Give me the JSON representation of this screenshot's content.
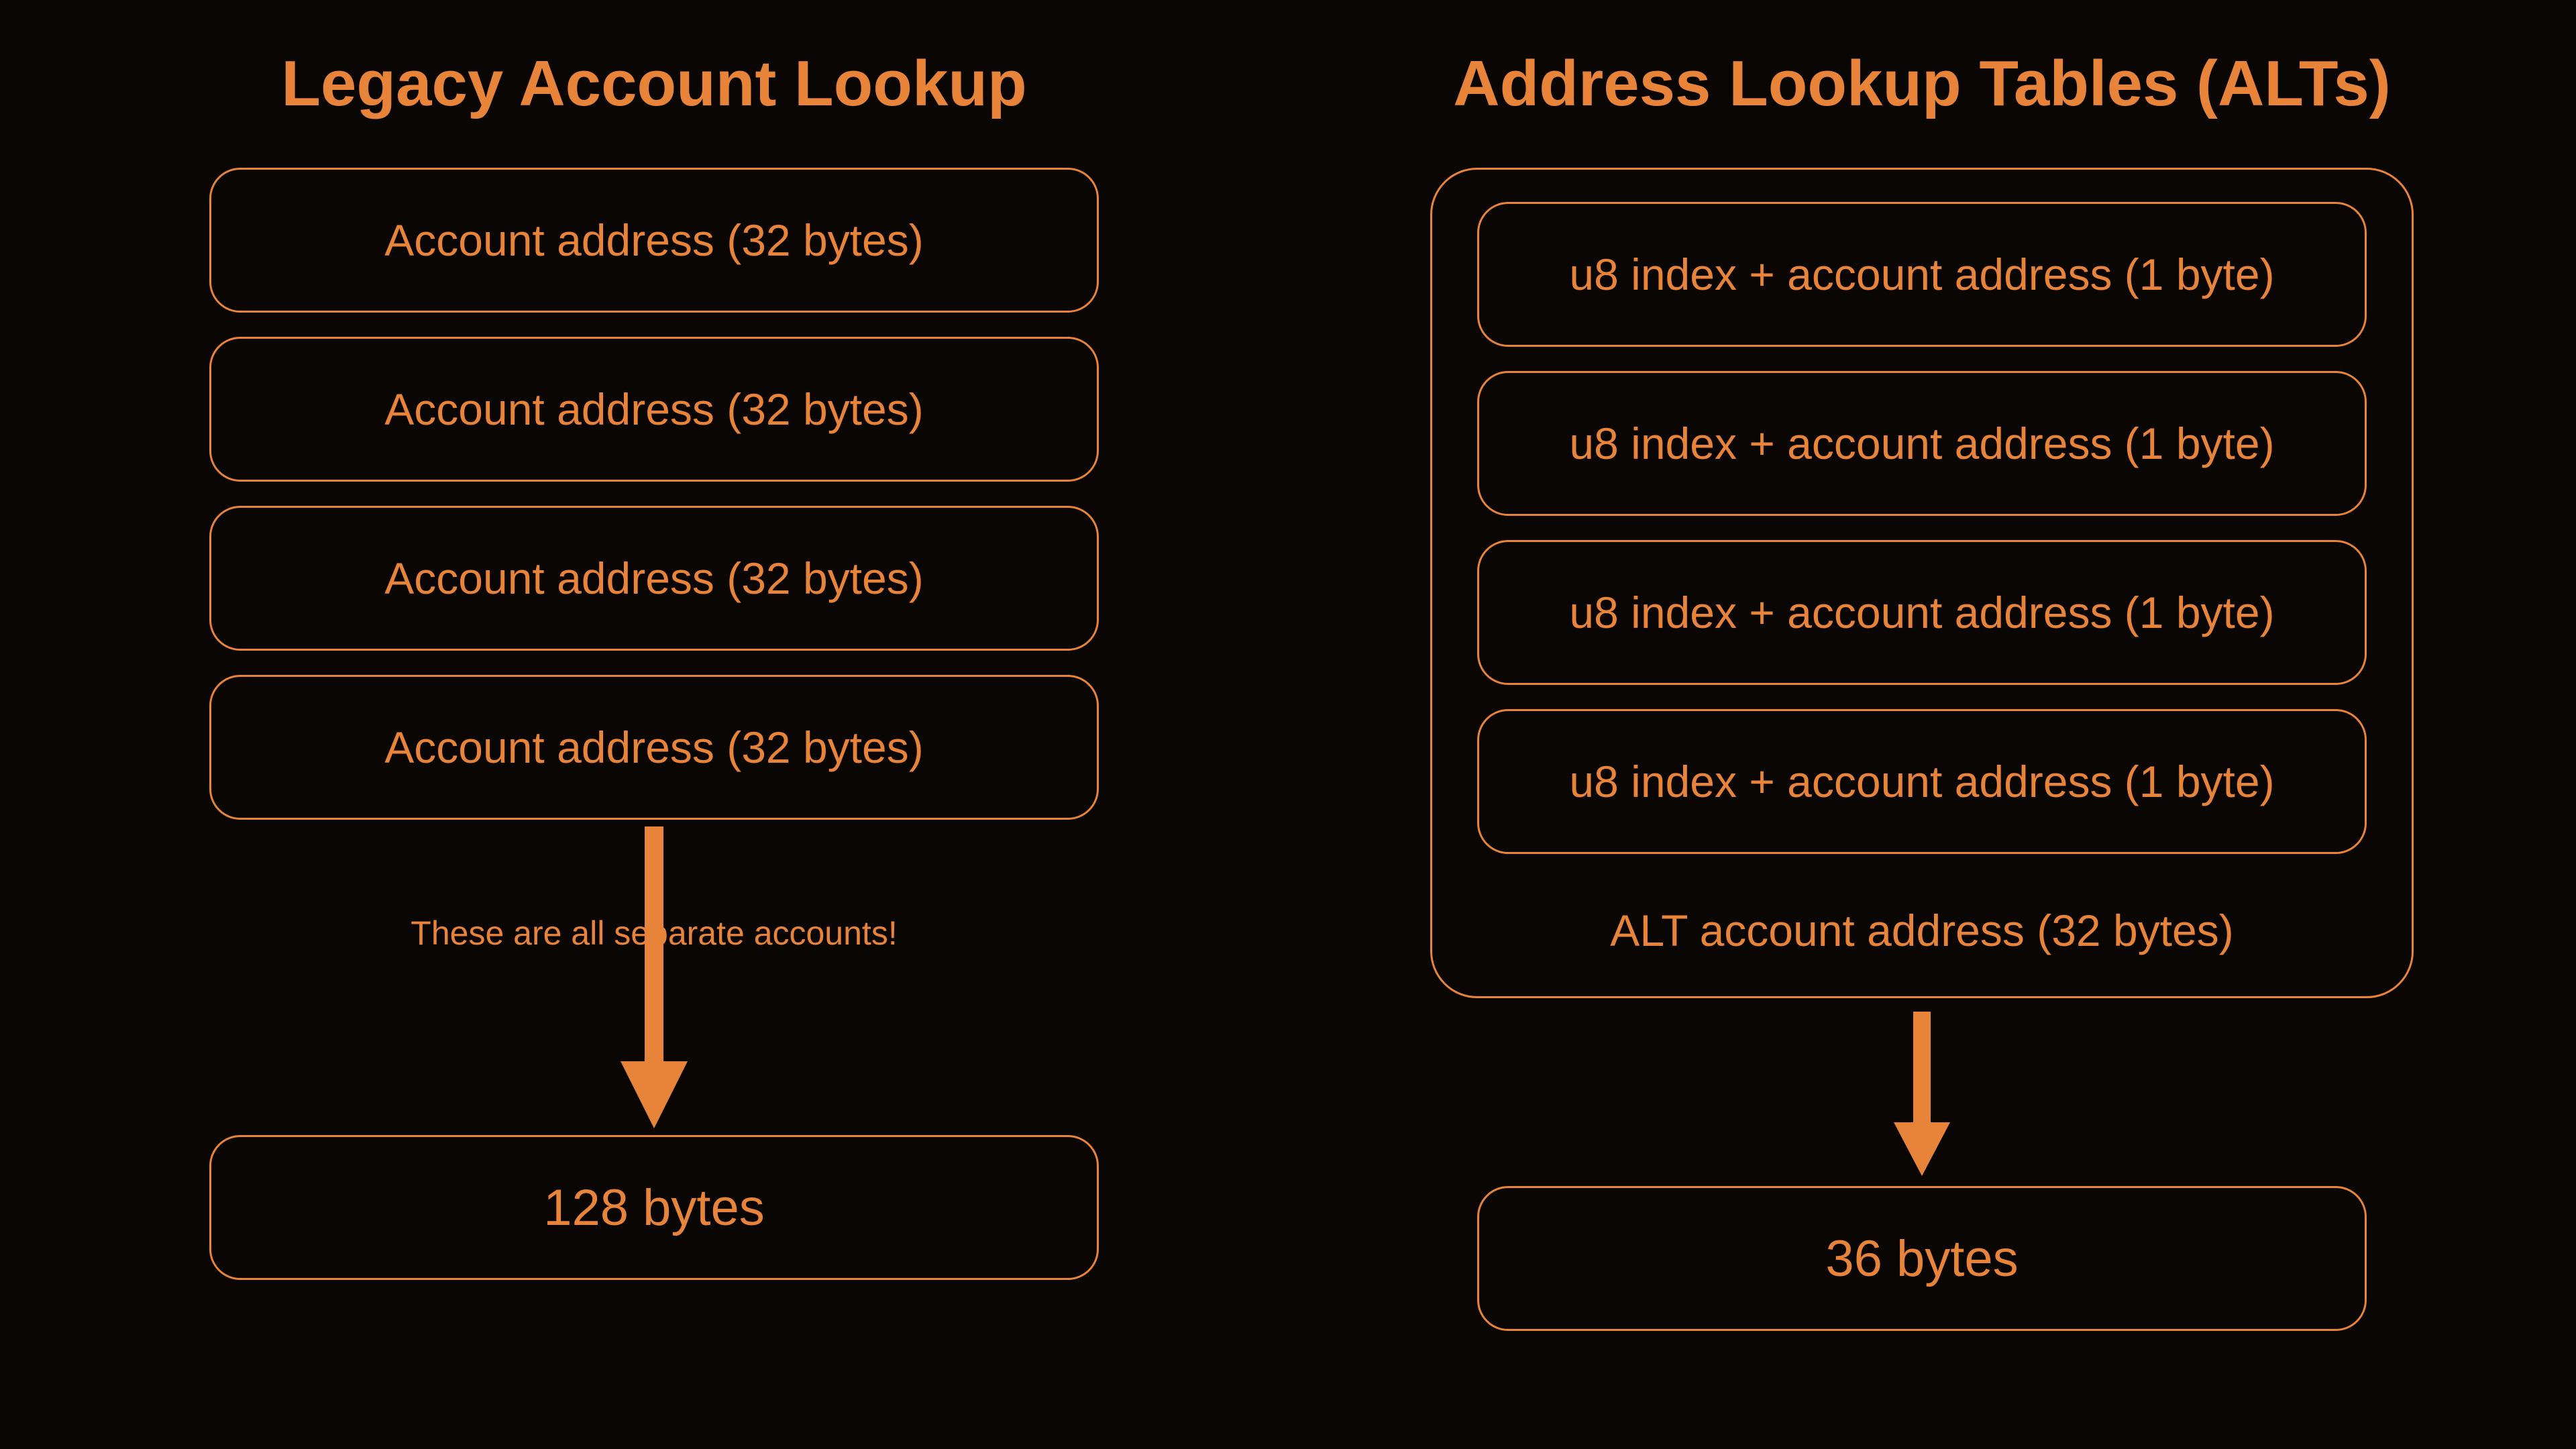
{
  "colors": {
    "accent": "#e8843a",
    "bg": "#0a0603"
  },
  "legacy": {
    "title": "Legacy Account Lookup",
    "entries": [
      "Account address (32 bytes)",
      "Account address (32 bytes)",
      "Account address (32 bytes)",
      "Account address (32 bytes)"
    ],
    "caption": "These are all separate accounts!",
    "result": "128 bytes"
  },
  "alt": {
    "title": "Address Lookup Tables (ALTs)",
    "entries": [
      "u8 index + account address (1 byte)",
      "u8 index + account address (1 byte)",
      "u8 index + account address (1 byte)",
      "u8 index + account address (1 byte)"
    ],
    "table_label": "ALT account address (32 bytes)",
    "result": "36 bytes"
  }
}
